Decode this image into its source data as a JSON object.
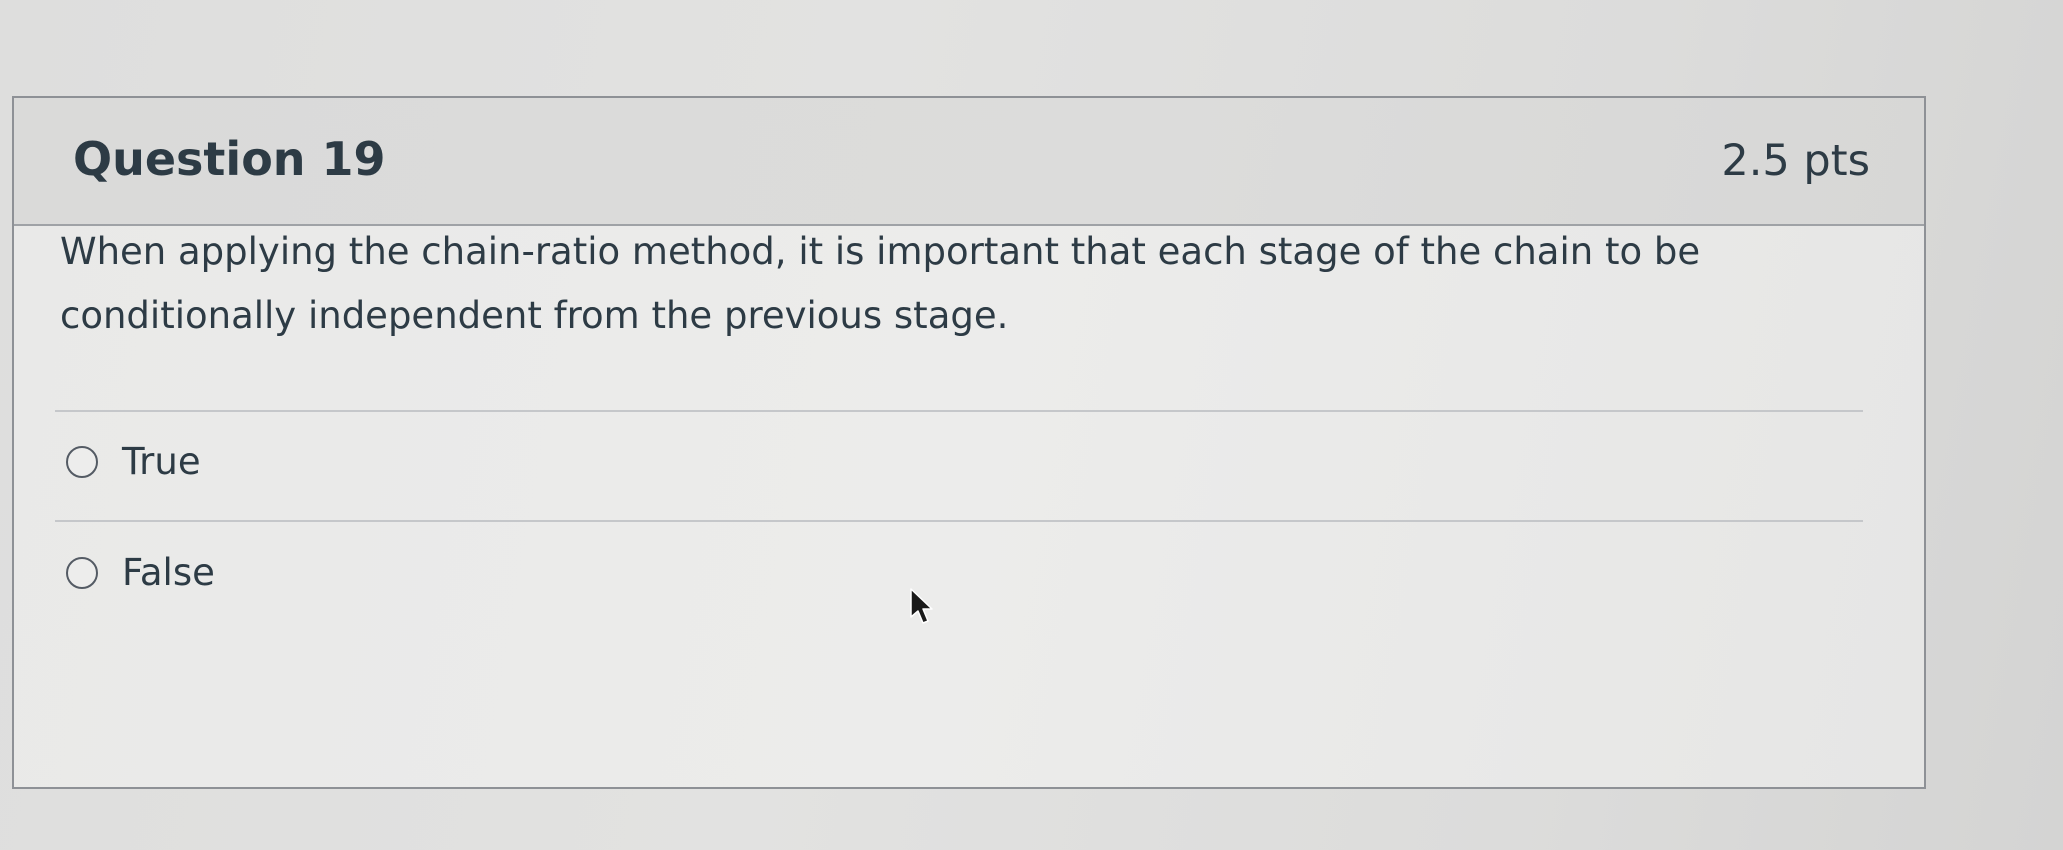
{
  "question": {
    "title": "Question 19",
    "points": "2.5 pts",
    "text": "When applying the chain-ratio method, it is important that each stage of the chain to be conditionally independent from the previous stage.",
    "answers": [
      {
        "label": "True",
        "selected": false
      },
      {
        "label": "False",
        "selected": false
      }
    ]
  },
  "icons": {
    "radio": "radio-unselected-icon",
    "cursor": "mouse-pointer-icon"
  },
  "colors": {
    "text": "#2d3b45",
    "header_background": "#dadad9",
    "card_border": "#8e9196"
  }
}
